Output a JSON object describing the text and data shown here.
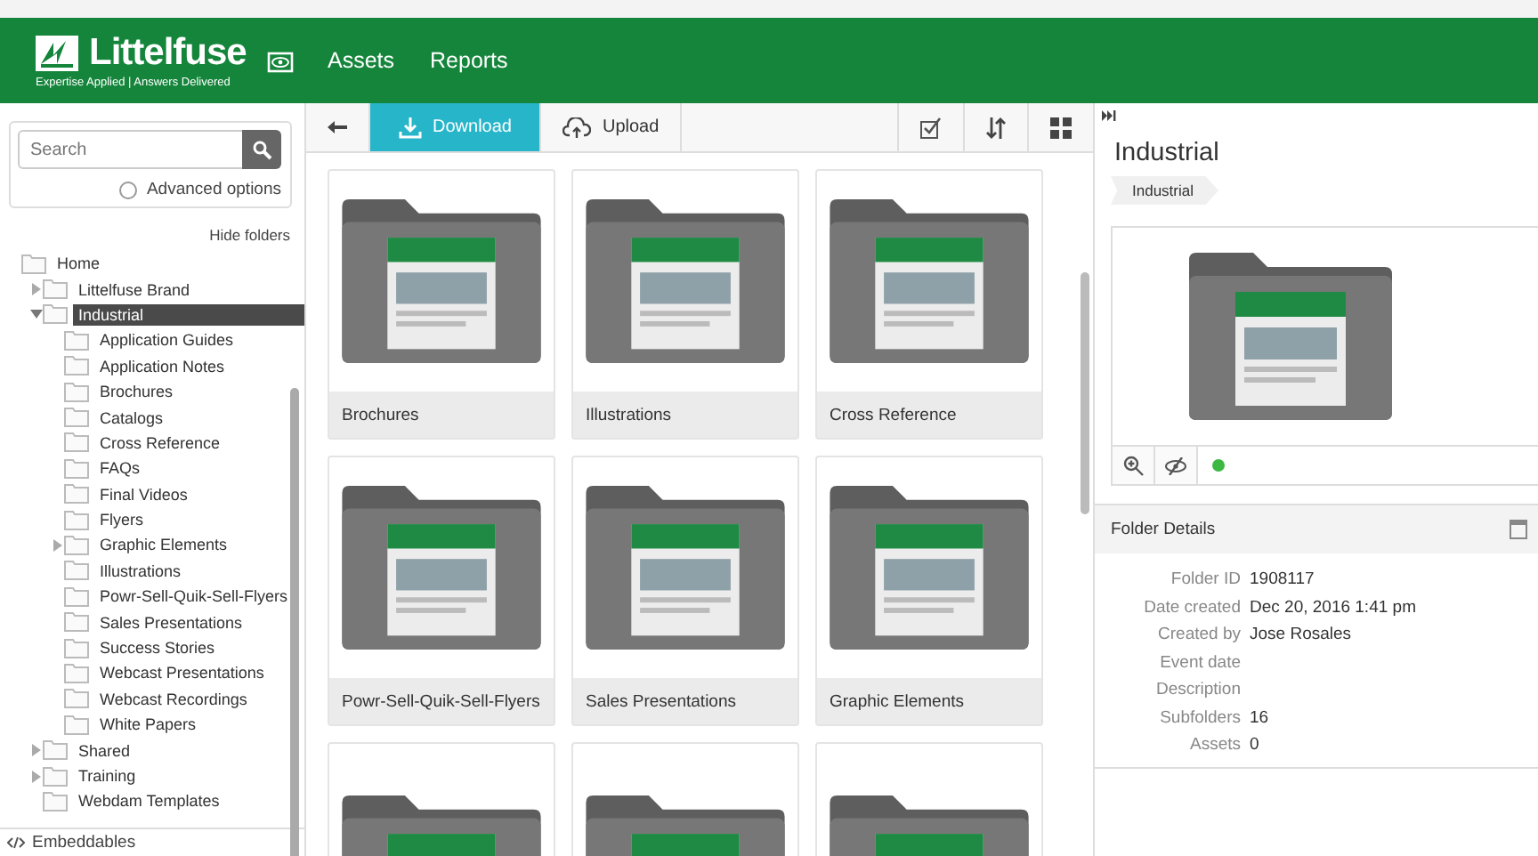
{
  "header": {
    "brand": "Littelfuse",
    "tagline": "Expertise Applied | Answers Delivered",
    "nav": [
      {
        "label": "Assets",
        "selected": false
      },
      {
        "label": "Reports",
        "selected": false
      }
    ]
  },
  "sidebar": {
    "search": {
      "placeholder": "Search"
    },
    "advanced_options": "Advanced options",
    "hide_folders": "Hide folders",
    "tree": [
      {
        "label": "Home",
        "selected": false,
        "children": [
          {
            "label": "Littelfuse Brand",
            "expanded": false,
            "selected": false
          },
          {
            "label": "Industrial",
            "expanded": true,
            "selected": true,
            "children": [
              {
                "label": "Application Guides",
                "selected": false
              },
              {
                "label": "Application Notes",
                "selected": false
              },
              {
                "label": "Brochures",
                "selected": false
              },
              {
                "label": "Catalogs",
                "selected": false
              },
              {
                "label": "Cross Reference",
                "selected": false
              },
              {
                "label": "FAQs",
                "selected": false
              },
              {
                "label": "Final Videos",
                "selected": false
              },
              {
                "label": "Flyers",
                "selected": false
              },
              {
                "label": "Graphic Elements",
                "expanded": false,
                "selected": false
              },
              {
                "label": "Illustrations",
                "selected": false
              },
              {
                "label": "Powr-Sell-Quik-Sell-Flyers",
                "selected": false
              },
              {
                "label": "Sales Presentations",
                "selected": false
              },
              {
                "label": "Success Stories",
                "selected": false
              },
              {
                "label": "Webcast Presentations",
                "selected": false
              },
              {
                "label": "Webcast Recordings",
                "selected": false
              },
              {
                "label": "White Papers",
                "selected": false
              }
            ]
          },
          {
            "label": "Shared",
            "expanded": false,
            "selected": false
          },
          {
            "label": "Training",
            "expanded": false,
            "selected": false
          },
          {
            "label": "Webdam Templates",
            "selected": false
          }
        ]
      }
    ],
    "footer": "Embeddables"
  },
  "toolbar": {
    "download": {
      "label": "Download",
      "selected": true
    },
    "upload": {
      "label": "Upload",
      "selected": false
    }
  },
  "folders": [
    {
      "kind": "folder",
      "label": "Brochures"
    },
    {
      "kind": "folder",
      "label": "Illustrations"
    },
    {
      "kind": "folder",
      "label": "Cross Reference"
    },
    {
      "kind": "folder",
      "label": "Powr-Sell-Quik-Sell-Flyers"
    },
    {
      "kind": "folder",
      "label": "Sales Presentations"
    },
    {
      "kind": "folder",
      "label": "Graphic Elements"
    },
    {
      "kind": "folder"
    },
    {
      "kind": "folder"
    },
    {
      "kind": "folder"
    }
  ],
  "details": {
    "title": "Industrial",
    "breadcrumb": "Industrial",
    "section_title": "Folder Details",
    "fields": [
      {
        "label": "Folder ID",
        "value": "1908117"
      },
      {
        "label": "Date created",
        "value": "Dec 20, 2016 1:41 pm"
      },
      {
        "label": "Created by",
        "value": "Jose Rosales"
      },
      {
        "label": "Event date"
      },
      {
        "label": "Description"
      },
      {
        "label": "Subfolders",
        "value": "16"
      },
      {
        "label": "Assets",
        "value": "0"
      }
    ]
  }
}
